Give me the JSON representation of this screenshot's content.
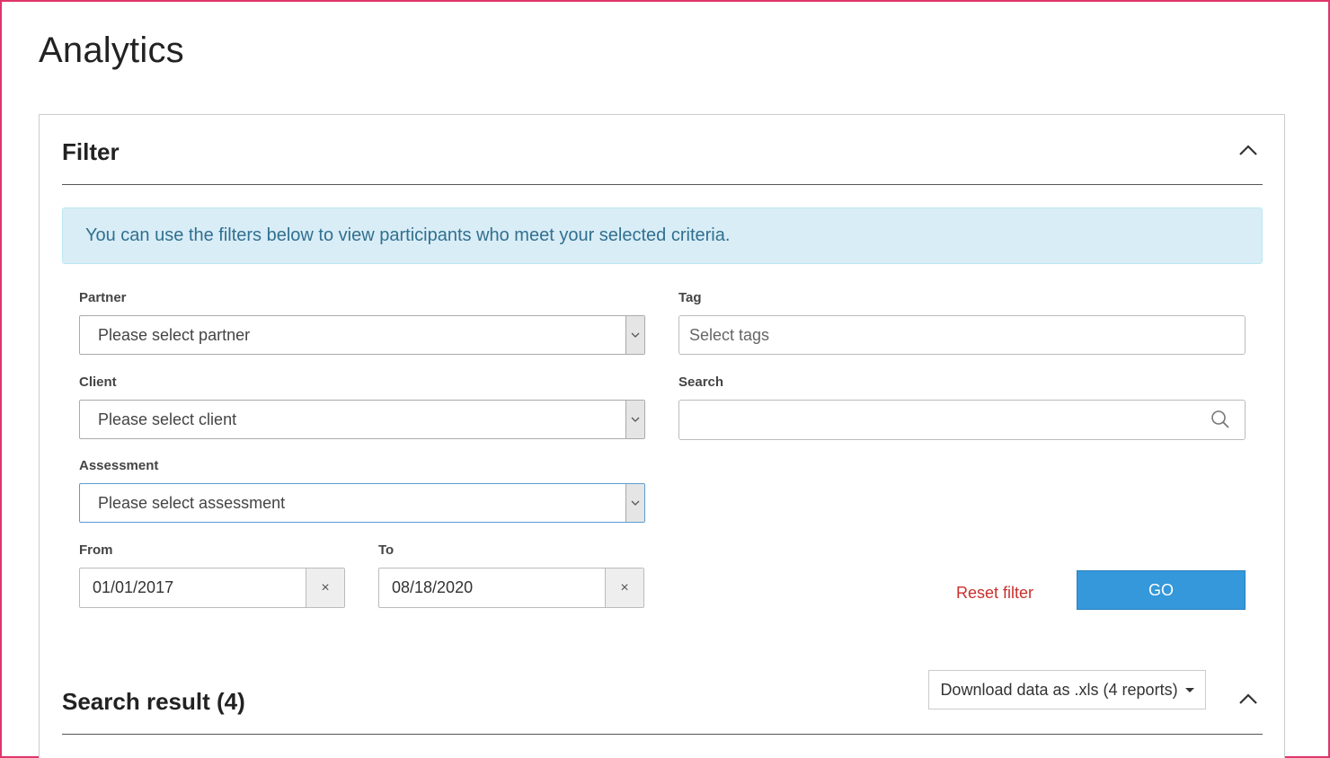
{
  "page": {
    "title": "Analytics"
  },
  "filter": {
    "title": "Filter",
    "info": "You can use the filters below to view participants who meet your selected criteria.",
    "partner": {
      "label": "Partner",
      "placeholder": "Please select partner"
    },
    "client": {
      "label": "Client",
      "placeholder": "Please select client"
    },
    "assessment": {
      "label": "Assessment",
      "placeholder": "Please select assessment"
    },
    "from": {
      "label": "From",
      "value": "01/01/2017",
      "clear": "×"
    },
    "to": {
      "label": "To",
      "value": "08/18/2020",
      "clear": "×"
    },
    "tag": {
      "label": "Tag",
      "placeholder": "Select tags"
    },
    "search": {
      "label": "Search",
      "value": ""
    },
    "reset_label": "Reset filter",
    "go_label": "GO"
  },
  "results": {
    "title": "Search result (4)",
    "download_label": "Download data as .xls (4 reports)"
  },
  "colors": {
    "accent": "#3498db",
    "danger": "#c9302c",
    "info_bg": "#d9edf7",
    "info_text": "#31708f",
    "frame": "#e0356b"
  },
  "icons": {
    "collapse": "chevron-up-icon",
    "select_arrow": "chevron-down-icon",
    "search": "search-icon",
    "clear": "close-icon",
    "caret": "caret-down-icon"
  }
}
